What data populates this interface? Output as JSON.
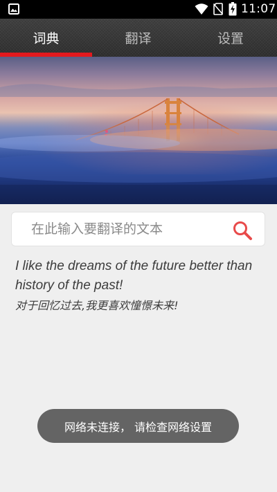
{
  "status_bar": {
    "time": "11:07",
    "icons": [
      "image-icon",
      "wifi-icon",
      "no-sim-icon",
      "battery-charging-icon"
    ]
  },
  "tabs": [
    {
      "label": "词典",
      "active": true
    },
    {
      "label": "翻译",
      "active": false
    },
    {
      "label": "设置",
      "active": false
    }
  ],
  "colors": {
    "accent": "#e3191e",
    "toolbar": "#333333",
    "background": "#efefef",
    "toast": "#646464"
  },
  "search": {
    "placeholder": "在此输入要翻译的文本",
    "value": ""
  },
  "daily_quote": {
    "english": "I like the dreams of the future better than history of the past!",
    "chinese": "对于回忆过去,我更喜欢憧憬未来!"
  },
  "toast": {
    "message": "网络未连接， 请检查网络设置"
  }
}
